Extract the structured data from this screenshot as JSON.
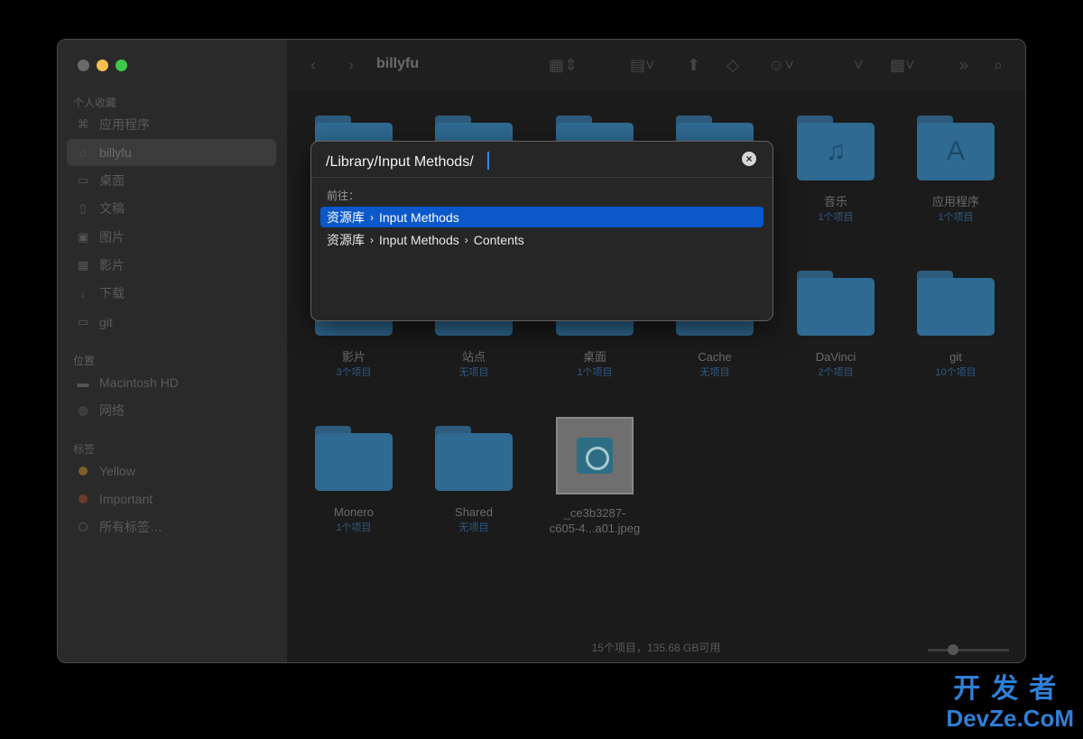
{
  "window": {
    "title": "billyfu",
    "colors": {
      "close": "#6a6a6a",
      "minimize": "#f5bf4f",
      "maximize": "#3ec94a",
      "accent": "#0a58ca",
      "folder": "#2f6a92"
    }
  },
  "sidebar": {
    "favorites_label": "个人收藏",
    "favorites": [
      {
        "label": "应用程序",
        "icon": "apps-icon"
      },
      {
        "label": "billyfu",
        "icon": "home-icon",
        "active": true
      },
      {
        "label": "桌面",
        "icon": "desktop-icon"
      },
      {
        "label": "文稿",
        "icon": "document-icon"
      },
      {
        "label": "图片",
        "icon": "photo-icon"
      },
      {
        "label": "影片",
        "icon": "movie-icon"
      },
      {
        "label": "下载",
        "icon": "download-icon"
      },
      {
        "label": "git",
        "icon": "folder-icon"
      }
    ],
    "locations_label": "位置",
    "locations": [
      {
        "label": "Macintosh HD",
        "icon": "disk-icon"
      },
      {
        "label": "网络",
        "icon": "network-icon"
      }
    ],
    "tags_label": "标签",
    "tags": [
      {
        "label": "Yellow",
        "color": "#7a5f2a"
      },
      {
        "label": "Important",
        "color": "#6a3b2a"
      },
      {
        "label": "所有标签…",
        "color": ""
      }
    ]
  },
  "toolbar": {
    "back_icon": "chevron-left-icon",
    "forward_icon": "chevron-right-icon"
  },
  "items": [
    {
      "name": "音乐",
      "count": "1个项目",
      "glyph": "♫"
    },
    {
      "name": "应用程序",
      "count": "1个项目",
      "glyph": "A"
    },
    {
      "name": "影片",
      "count": "3个项目",
      "glyph": ""
    },
    {
      "name": "站点",
      "count": "无项目",
      "glyph": ""
    },
    {
      "name": "桌面",
      "count": "1个项目",
      "glyph": ""
    },
    {
      "name": "Cache",
      "count": "无项目",
      "glyph": ""
    },
    {
      "name": "DaVinci",
      "count": "2个项目",
      "glyph": ""
    },
    {
      "name": "git",
      "count": "10个项目",
      "glyph": ""
    },
    {
      "name": "Monero",
      "count": "1个项目",
      "glyph": ""
    },
    {
      "name": "Shared",
      "count": "无项目",
      "glyph": ""
    },
    {
      "name_line1": "_ce3b3287-",
      "name_line2": "c605-4...a01.jpeg"
    }
  ],
  "status": {
    "text": "15个项目，135.68 GB可用"
  },
  "goto": {
    "value": "/Library/Input Methods/",
    "label": "前往：",
    "suggestions": [
      {
        "parts": [
          "资源库",
          "Input Methods"
        ]
      },
      {
        "parts": [
          "资源库",
          "Input Methods",
          "Contents"
        ]
      }
    ]
  },
  "watermark": {
    "cn": "开发者",
    "en": "DevZe.CoM"
  }
}
